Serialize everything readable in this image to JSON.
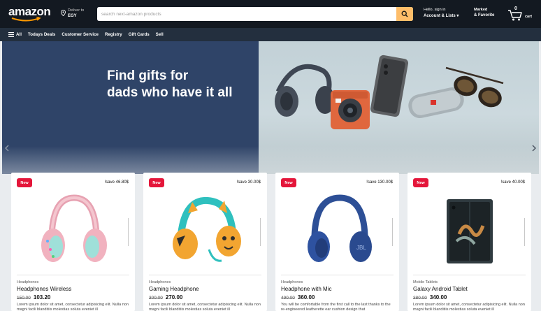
{
  "header": {
    "logo": "amazon",
    "deliver_line1": "Deliver to",
    "deliver_line2": "EGY",
    "search_placeholder": "search next-amazon products",
    "account_line1": "Hello, sign in",
    "account_line2": "Account & Lists",
    "wishlist_line1": "Marked",
    "wishlist_line2": "& Favorite",
    "cart_count": "0",
    "cart_label": "cart",
    "colors": {
      "bar": "#131921",
      "search_button": "#febd69"
    }
  },
  "nav": {
    "items": [
      {
        "label": "All",
        "icon": "menu-icon"
      },
      {
        "label": "Todays Deals"
      },
      {
        "label": "Customer Service"
      },
      {
        "label": "Registry"
      },
      {
        "label": "Gift Cards"
      },
      {
        "label": "Sell"
      }
    ],
    "color": "#232f3e"
  },
  "hero": {
    "title_line1": "Find gifts for",
    "title_line2": "dads who have it all",
    "left_color": "#2f4468"
  },
  "products": [
    {
      "badge": "New",
      "save": "!save 46.80$",
      "category": "Headphones",
      "name": "Headphones Wireless",
      "old_price": "150.00",
      "price": "103.20",
      "description": "Lorem ipsum dolor sit amet, consectetur adipisicing elit. Nulla non magni facili blanditiis molestias soluta eveniet ill",
      "image": "pink-headphones-image"
    },
    {
      "badge": "New",
      "save": "!save 30.00$",
      "category": "Headphones",
      "name": "Gaming Headphone",
      "old_price": "300.00",
      "price": "270.00",
      "description": "Lorem ipsum dolor sit amet, consectetur adipisicing elit. Nulla non magni facili blanditiis molestias soluta eveniet ill",
      "image": "kids-headphones-image"
    },
    {
      "badge": "New",
      "save": "!save 130.00$",
      "category": "Headphones",
      "name": "Headphone with Mic",
      "old_price": "490.00",
      "price": "360.00",
      "description": "You will be comfortable from the first call to the last thanks to the re-engineered leatherette ear cushion design that",
      "image": "blue-headphones-image"
    },
    {
      "badge": "New",
      "save": "!save 40.00$",
      "category": "Mobile Tablets",
      "name": "Galaxy Android Tablet",
      "old_price": "380.00",
      "price": "340.00",
      "description": "Lorem ipsum dolor sit amet, consectetur adipisicing elit. Nulla non magni facili blanditiis molestias soluta eveniet ill",
      "image": "foldable-phone-image"
    }
  ],
  "colors": {
    "badge": "#e4163a",
    "page_bg": "#e9ecef"
  }
}
